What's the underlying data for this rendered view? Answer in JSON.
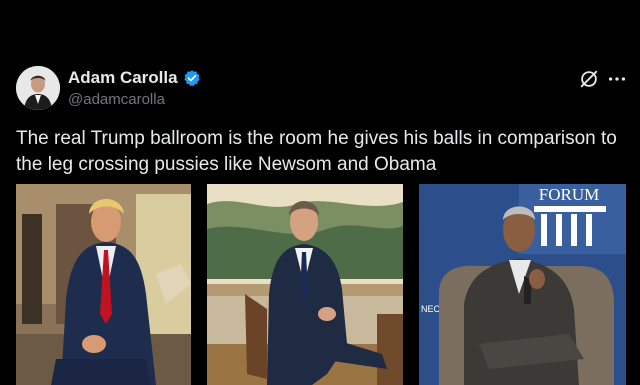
{
  "author": {
    "name": "Adam Carolla",
    "handle": "@adamcarolla",
    "verified_color": "#1d9bf0"
  },
  "post": {
    "text": "The real Trump ballroom is the room he gives his balls in comparison to the leg crossing pussies like Newsom and Obama"
  },
  "icons": {
    "verified": "verified-badge-icon",
    "grok": "grok-icon",
    "more": "more-options-icon"
  },
  "media": {
    "photo3_sign": "FORUM",
    "photo3_banner": "NEC\nT"
  }
}
